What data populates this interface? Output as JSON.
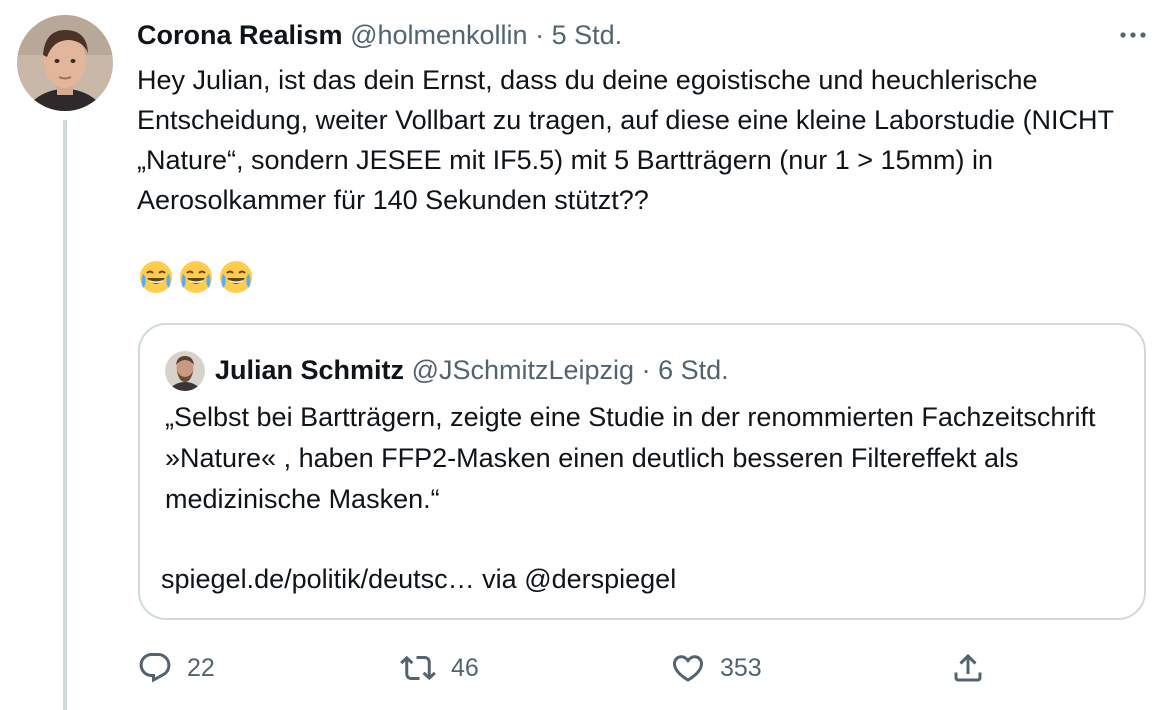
{
  "tweet": {
    "author_name": "Corona Realism",
    "author_handle": "@holmenkollin",
    "separator": "·",
    "time": "5 Std.",
    "text": "Hey Julian, ist das dein Ernst, dass du deine egoistische und heuchlerische Entscheidung, weiter Vollbart zu tragen, auf diese eine kleine Laborstudie (NICHT „Nature“, sondern JESEE mit IF5.5) mit 5 Bartträgern (nur 1 > 15mm) in Aerosolkammer für 140 Sekunden stützt??",
    "emoji": [
      "😂",
      "😂",
      "😂"
    ],
    "more_icon": "more-horizontal-icon"
  },
  "quote": {
    "author_name": "Julian Schmitz",
    "author_handle": "@JSchmitzLeipzig",
    "separator": "·",
    "time": "6 Std.",
    "text": "„Selbst bei Bartträgern, zeigte eine Studie in der renommierten Fachzeitschrift »Nature« , haben FFP2-Masken einen deutlich besseren Filtereffekt als medizinische Masken.“",
    "link_text": "spiegel.de/politik/deutsc… via @derspiegel"
  },
  "actions": {
    "reply_count": "22",
    "retweet_count": "46",
    "like_count": "353"
  },
  "colors": {
    "text": "#0f1419",
    "secondary": "#536471",
    "border": "#cfd9de"
  }
}
